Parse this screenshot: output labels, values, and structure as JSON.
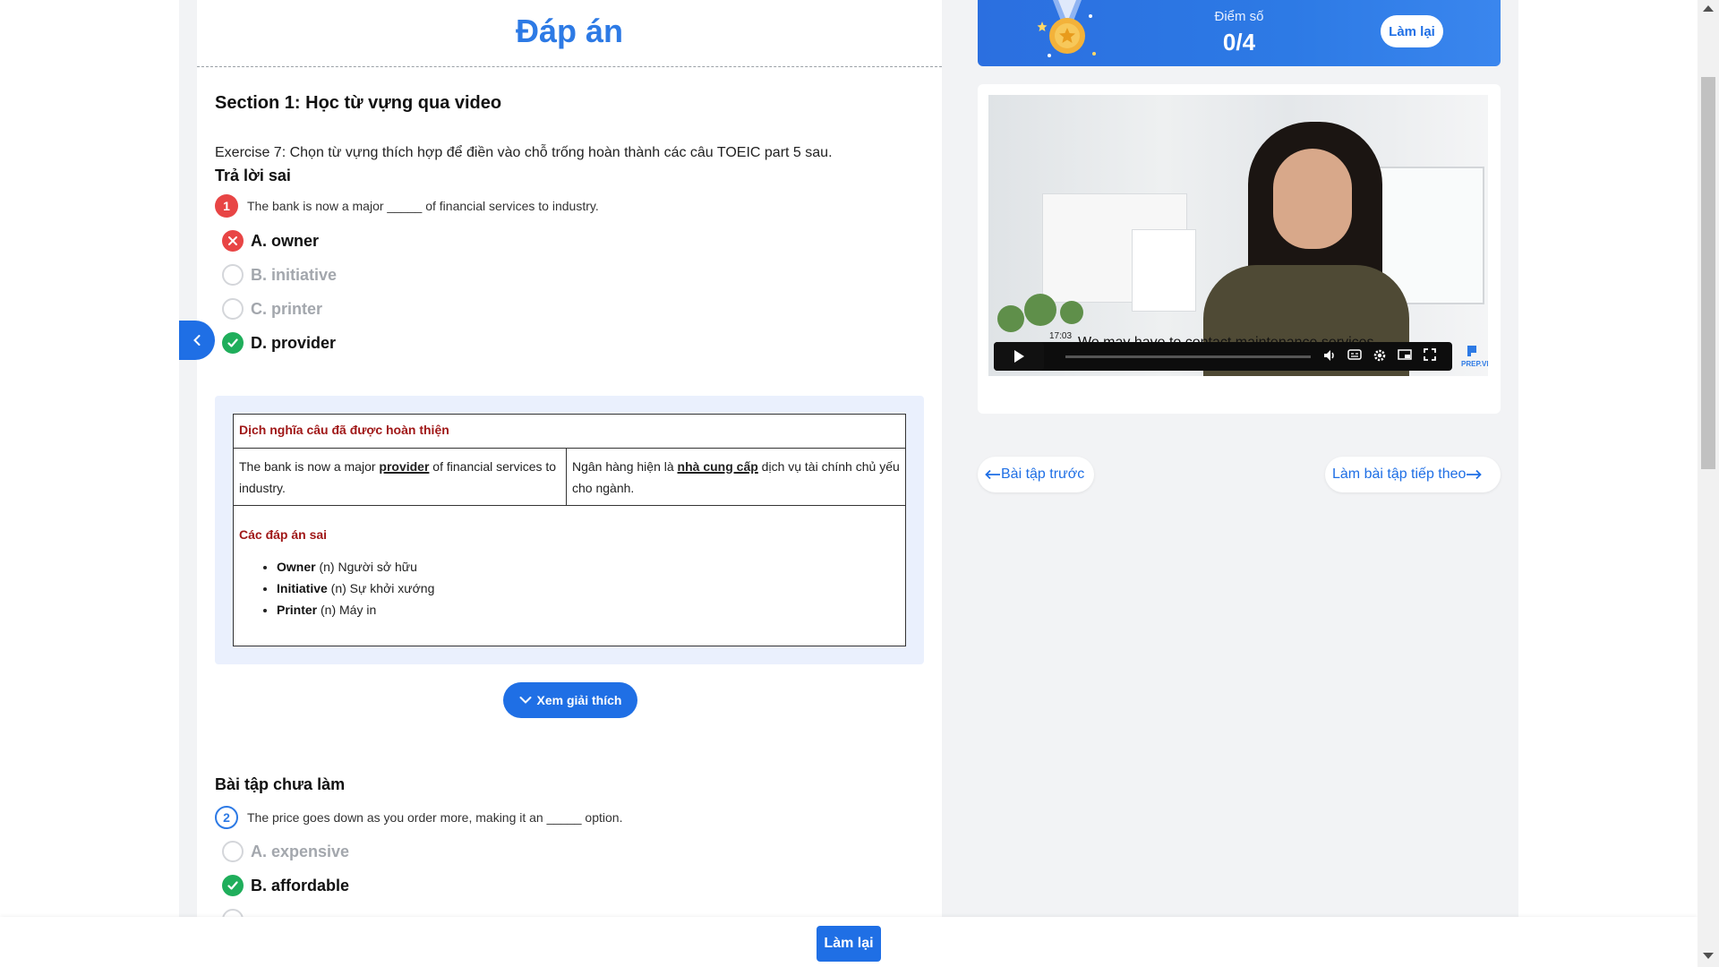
{
  "answer_title": "Đáp án",
  "section_title": "Section 1: Học từ vựng qua video",
  "exercise_title": "Exercise 7: Chọn từ vựng thích hợp để điền vào chỗ trống hoàn thành các câu TOEIC part 5 sau.",
  "question1": {
    "status_label": "Trả lời sai",
    "number": "1",
    "text": "The bank is now a major _____ of financial services to industry.",
    "options": [
      {
        "label": "A. owner",
        "state": "wrong"
      },
      {
        "label": "B. initiative",
        "state": "none"
      },
      {
        "label": "C. printer",
        "state": "none"
      },
      {
        "label": "D. provider",
        "state": "correct"
      }
    ]
  },
  "explanation": {
    "table_heading": "Dịch nghĩa câu đã được hoàn thiện",
    "en_before": "The bank is now a major ",
    "en_highlight": "provider",
    "en_after": " of financial services to industry.",
    "vi_before": "Ngân hàng hiện là ",
    "vi_highlight": "nhà cung cấp",
    "vi_after": " dịch vụ tài chính chủ yếu cho ngành.",
    "wrong_heading": "Các đáp án sai",
    "wrong_items": [
      {
        "word": "Owner",
        "meaning": " (n) Người sở hữu"
      },
      {
        "word": "Initiative",
        "meaning": " (n) Sự khởi xướng"
      },
      {
        "word": "Printer",
        "meaning": " (n) Máy in"
      }
    ],
    "toggle_label": "Xem giải thích"
  },
  "question2": {
    "status_label": "Bài tập chưa làm",
    "number": "2",
    "text": "The price goes down as you order more, making it an _____ option.",
    "options": [
      {
        "label": "A. expensive",
        "state": "none"
      },
      {
        "label": "B. affordable",
        "state": "correct"
      }
    ]
  },
  "score": {
    "label": "Điểm số",
    "value": "0/4",
    "retry_label": "Làm lại"
  },
  "video": {
    "timestamp": "17:03",
    "caption": "We may have to contact maintenance services",
    "logo": "PREP.VN"
  },
  "nav": {
    "prev_label": "Bài tập trước",
    "next_label": "Làm bài tập tiếp theo"
  },
  "footer": {
    "retry_label": "Làm lại"
  },
  "colors": {
    "accent": "#1f6fe5",
    "title_blue": "#2d7ae5",
    "wrong": "#e84545",
    "correct": "#1fae5b",
    "explain_bg": "#eaf0fd",
    "heading_red": "#a01818"
  }
}
